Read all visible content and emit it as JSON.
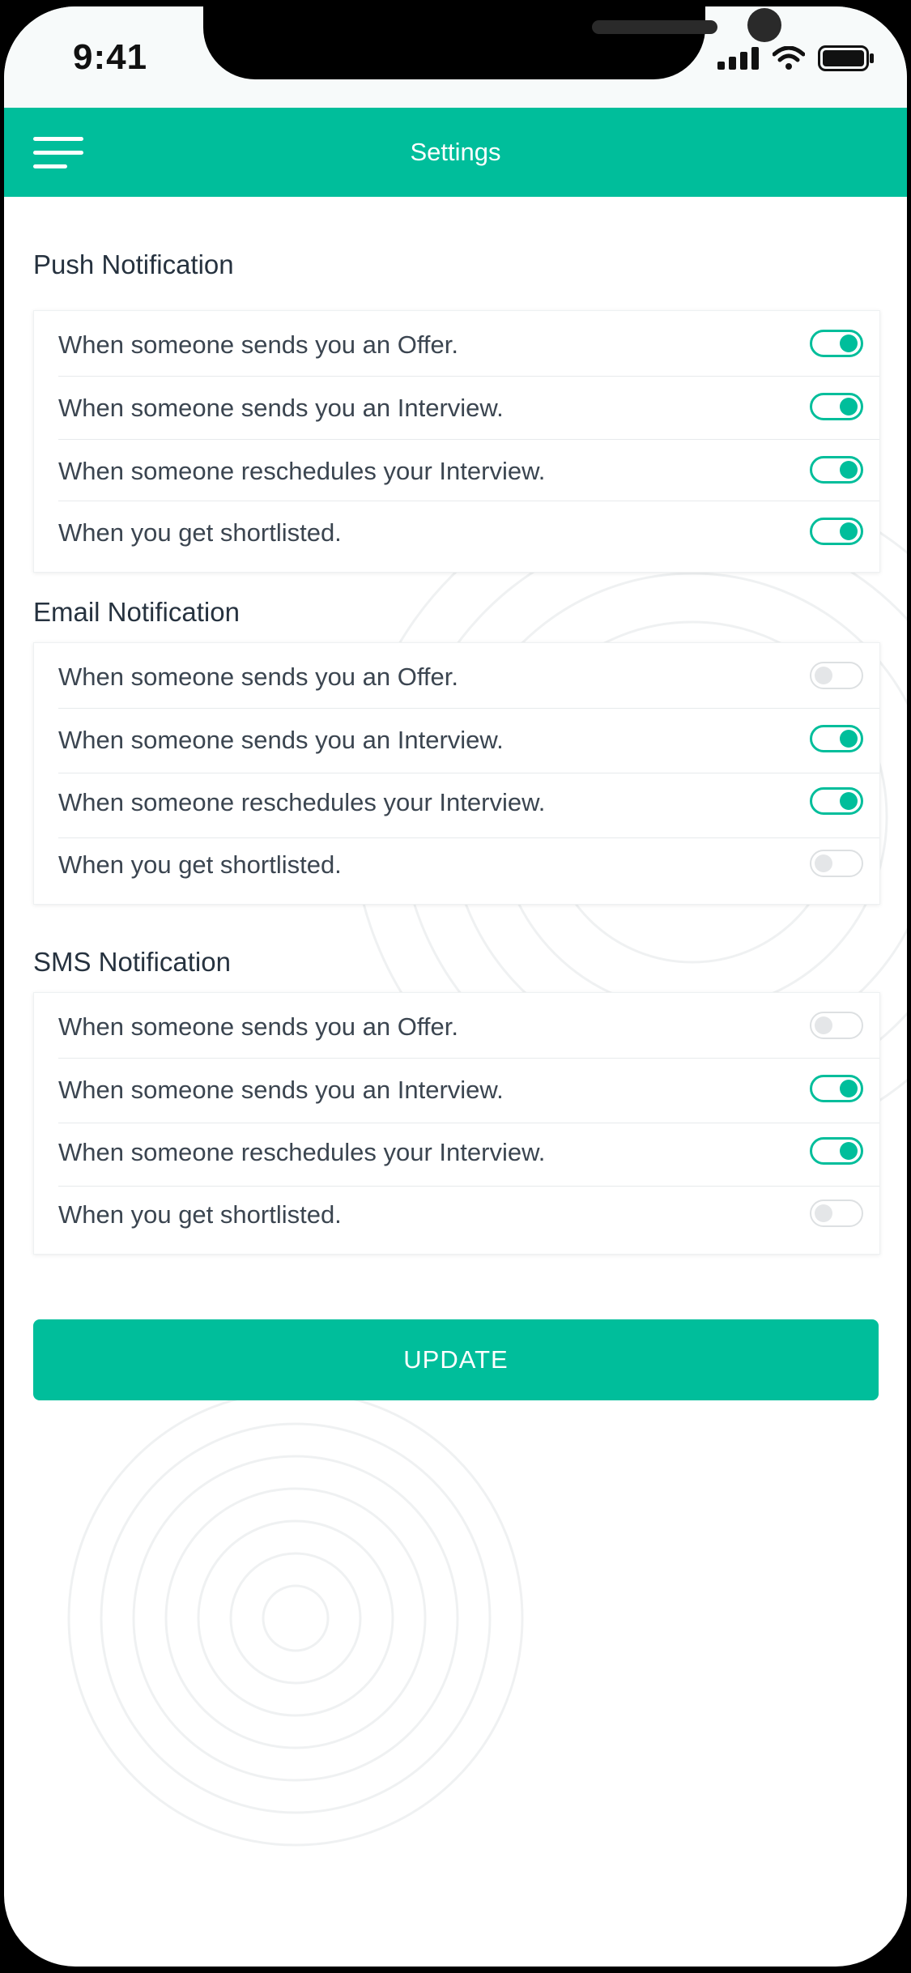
{
  "status_bar": {
    "time": "9:41"
  },
  "header": {
    "title": "Settings",
    "menu_icon": "hamburger-menu-icon",
    "background_color": "#00be9b"
  },
  "sections": [
    {
      "title": "Push Notification",
      "items": [
        {
          "label": "When someone sends you an Offer.",
          "enabled": true
        },
        {
          "label": "When someone sends you an Interview.",
          "enabled": true
        },
        {
          "label": "When someone reschedules your Interview.",
          "enabled": true
        },
        {
          "label": "When you get shortlisted.",
          "enabled": true
        }
      ]
    },
    {
      "title": "Email Notification",
      "items": [
        {
          "label": "When someone sends you an Offer.",
          "enabled": false
        },
        {
          "label": "When someone sends you an Interview.",
          "enabled": true
        },
        {
          "label": "When someone reschedules your Interview.",
          "enabled": true
        },
        {
          "label": "When you get shortlisted.",
          "enabled": false
        }
      ]
    },
    {
      "title": "SMS Notification",
      "items": [
        {
          "label": "When someone sends you an Offer.",
          "enabled": false
        },
        {
          "label": "When someone sends you an Interview.",
          "enabled": true
        },
        {
          "label": "When someone reschedules your Interview.",
          "enabled": true
        },
        {
          "label": "When you get shortlisted.",
          "enabled": false
        }
      ]
    }
  ],
  "update_button": {
    "label": "UPDATE"
  },
  "colors": {
    "accent": "#00be9b",
    "toggle_off": "#e4e6e8"
  }
}
